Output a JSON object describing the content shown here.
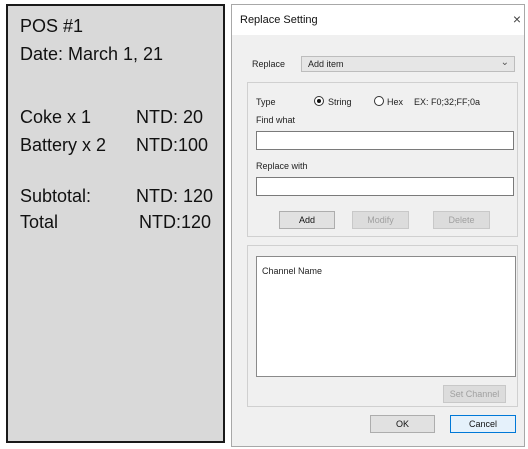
{
  "receipt": {
    "title": "POS #1",
    "date": "Date: March 1, 21",
    "items": [
      {
        "name": "Coke x 1",
        "price": "NTD: 20"
      },
      {
        "name": "Battery x 2",
        "price": "NTD:100"
      }
    ],
    "subtotal_label": "Subtotal:",
    "subtotal_value": "NTD: 120",
    "total_label": "Total",
    "total_value": "NTD:120"
  },
  "dialog": {
    "title": "Replace Setting",
    "close_glyph": "×",
    "replace_label": "Replace",
    "replace_selected": "Add item",
    "type_label": "Type",
    "type_options": [
      {
        "label": "String",
        "checked": true
      },
      {
        "label": "Hex",
        "checked": false
      }
    ],
    "example": "EX:  F0;32;FF;0a",
    "find_label": "Find what",
    "find_value": "",
    "replace_with_label": "Replace with",
    "replace_with_value": "",
    "buttons": {
      "add": "Add",
      "modify": "Modify",
      "delete": "Delete"
    },
    "channel_header": "Channel Name",
    "set_channel": "Set Channel",
    "ok": "OK",
    "cancel": "Cancel"
  },
  "colors": {
    "receipt_bg": "#d9d9d9",
    "dialog_bg": "#f0f0f0",
    "accent": "#0078d7"
  },
  "icons": {
    "combo_arrow": "chevron-down-icon",
    "close": "close-icon"
  }
}
